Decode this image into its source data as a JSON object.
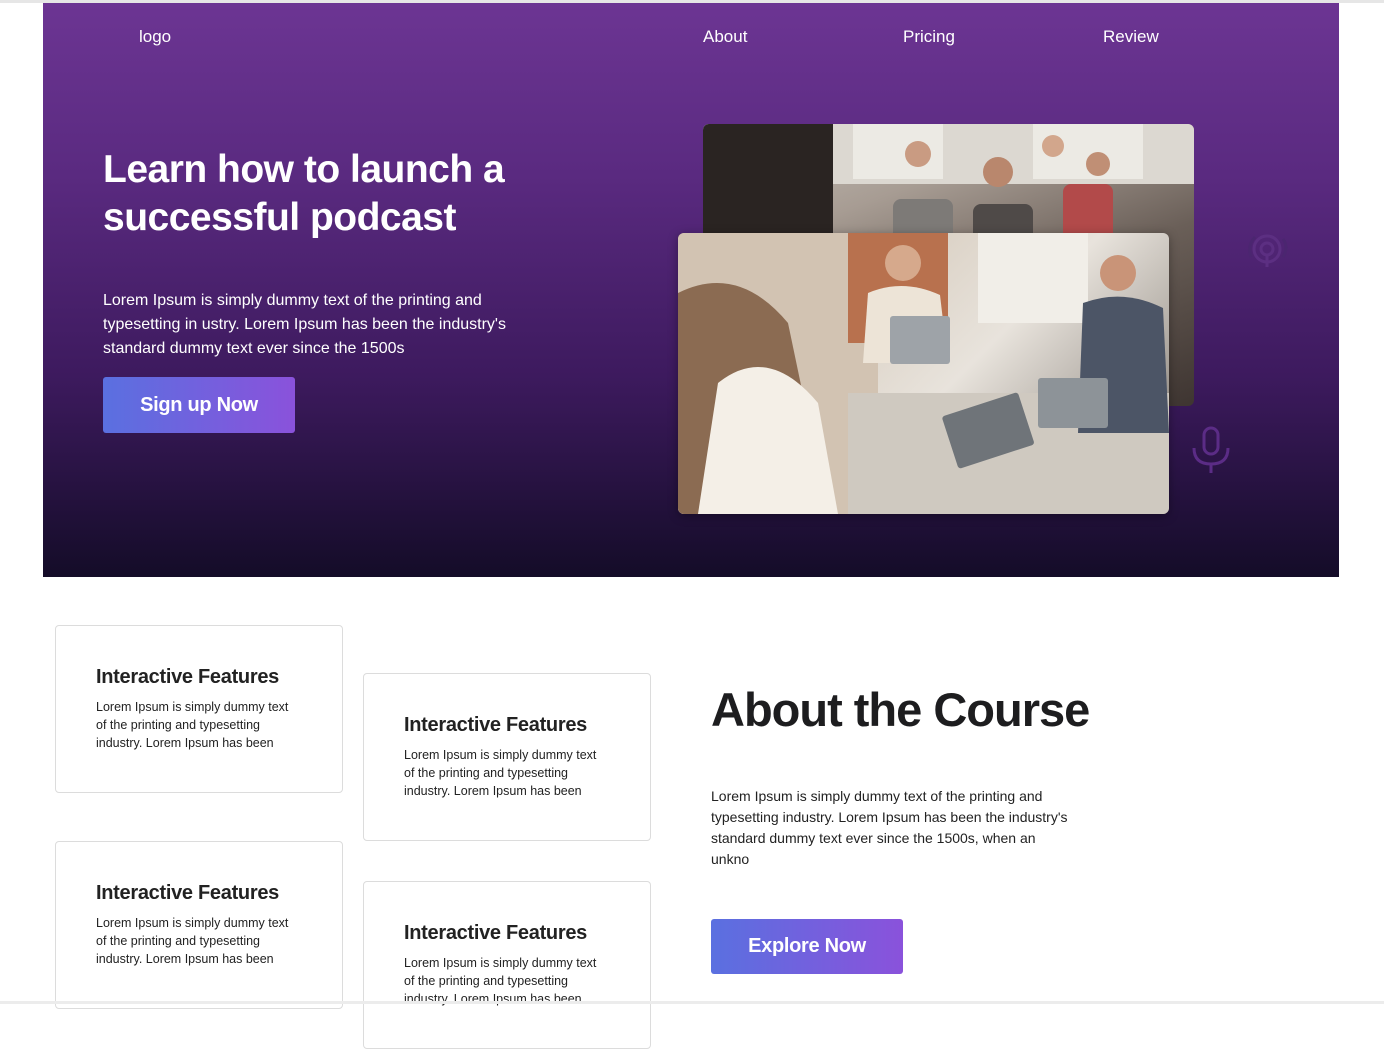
{
  "nav": {
    "logo": "logo",
    "links": [
      "About",
      "Pricing",
      "Review"
    ]
  },
  "hero": {
    "title": "Learn how to launch a successful podcast",
    "text": "Lorem Ipsum is simply dummy text of the printing and typesetting in ustry. Lorem Ipsum has been the industry's standard dummy text ever since the 1500s",
    "cta": "Sign up Now"
  },
  "features": [
    {
      "title": "Interactive Features",
      "text": "Lorem Ipsum is simply dummy text of the printing and typesetting industry. Lorem Ipsum has been"
    },
    {
      "title": "Interactive Features",
      "text": "Lorem Ipsum is simply dummy text of the printing and typesetting industry. Lorem Ipsum has been"
    },
    {
      "title": "Interactive Features",
      "text": "Lorem Ipsum is simply dummy text of the printing and typesetting industry. Lorem Ipsum has been"
    },
    {
      "title": "Interactive Features",
      "text": "Lorem Ipsum is simply dummy text of the printing and typesetting industry. Lorem Ipsum has been"
    }
  ],
  "about": {
    "title": "About the Course",
    "text": "Lorem Ipsum is simply dummy text of the printing and typesetting industry. Lorem Ipsum has been the industry's standard dummy text ever since the 1500s, when an unkno",
    "cta": "Explore Now"
  },
  "colors": {
    "hero_top": "#6c3593",
    "hero_bottom": "#140c28",
    "button_start": "#5a70e0",
    "button_end": "#8a52db",
    "heading": "#1d1d1f"
  }
}
